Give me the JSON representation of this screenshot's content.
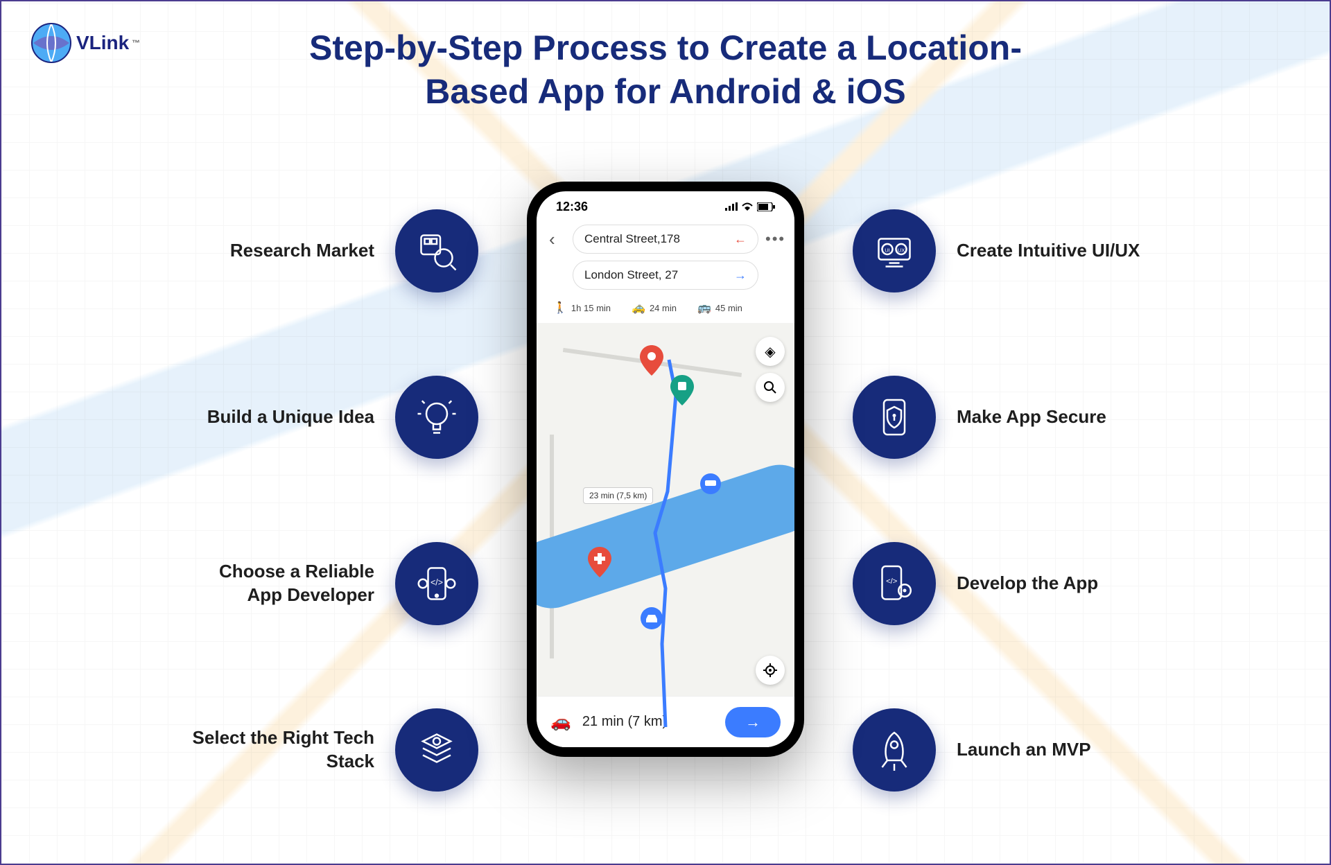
{
  "brand": "VLink",
  "title_line1": "Step-by-Step Process to Create a Location-",
  "title_line2": "Based App for Android & iOS",
  "left_steps": [
    {
      "label": "Research Market",
      "icon": "research"
    },
    {
      "label": "Build a Unique Idea",
      "icon": "idea"
    },
    {
      "label": "Choose a Reliable App Developer",
      "icon": "developer"
    },
    {
      "label": "Select the Right Tech Stack",
      "icon": "stack"
    }
  ],
  "right_steps": [
    {
      "label": "Create Intuitive UI/UX",
      "icon": "uiux"
    },
    {
      "label": "Make App Secure",
      "icon": "secure"
    },
    {
      "label": "Develop the App",
      "icon": "develop"
    },
    {
      "label": "Launch an MVP",
      "icon": "launch"
    }
  ],
  "phone": {
    "time": "12:36",
    "from_address": "Central Street,178",
    "to_address": "London Street, 27",
    "modes": {
      "walk": "1h 15 min",
      "taxi": "24 min",
      "bus": "45 min"
    },
    "route_label": "23 min (7,5 km)",
    "bottom_eta": "21 min (7 km)"
  }
}
